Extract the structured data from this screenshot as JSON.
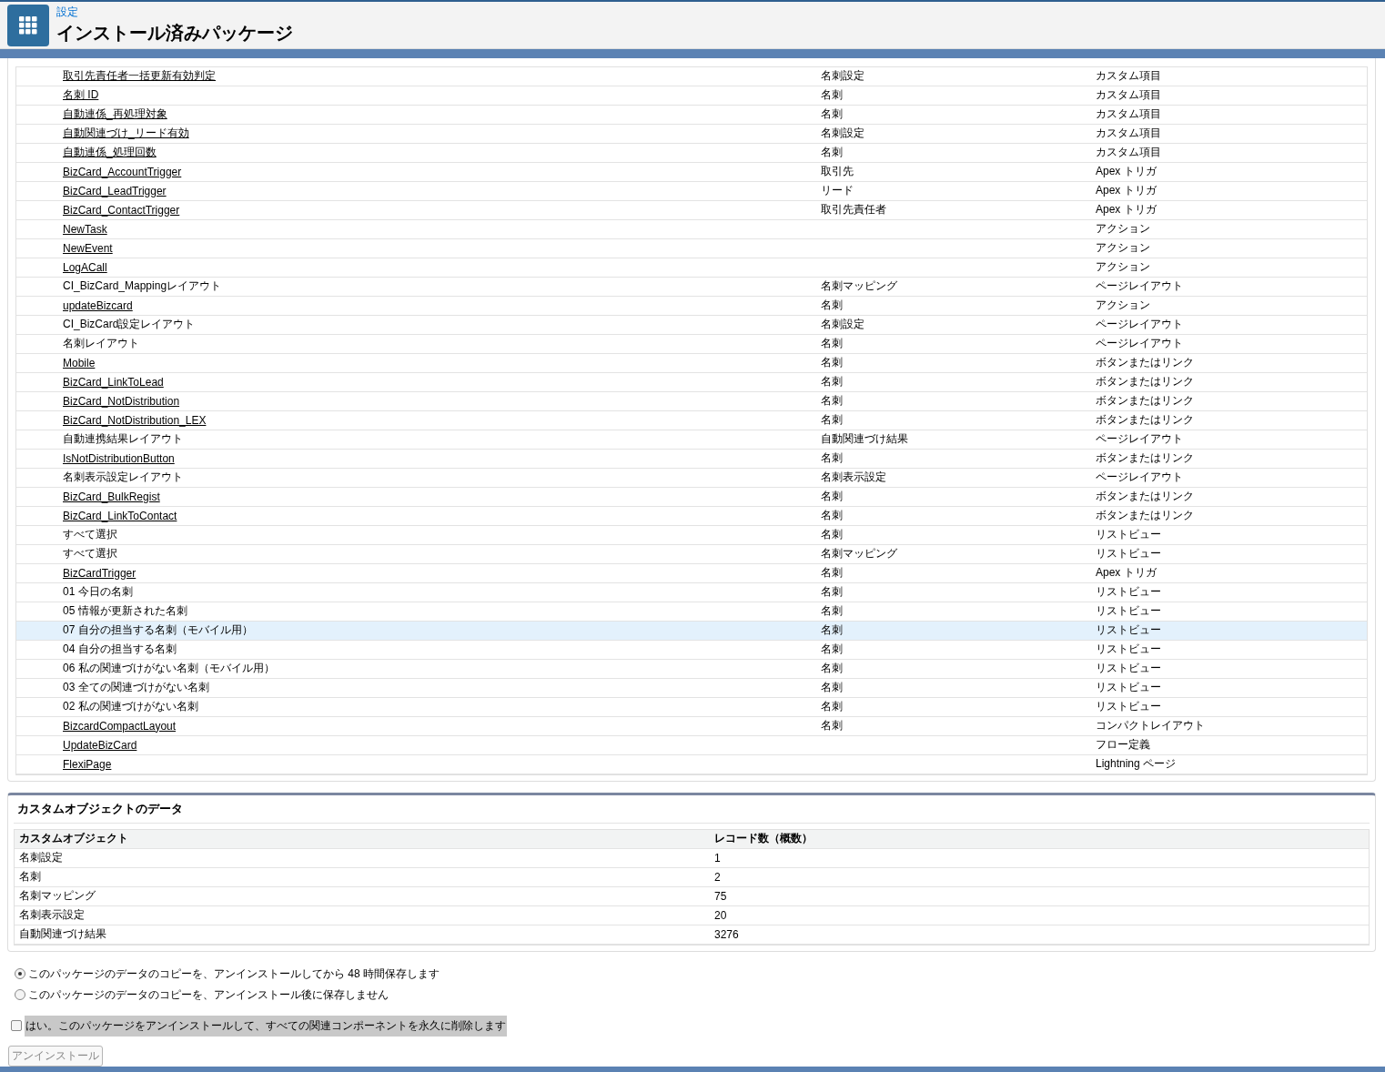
{
  "header": {
    "breadcrumb": "設定",
    "title": "インストール済みパッケージ"
  },
  "components": {
    "rows": [
      {
        "name": "取引先責任者一括更新有効判定",
        "kind": "link",
        "object": "名刺設定",
        "type": "カスタム項目",
        "highlighted": false
      },
      {
        "name": "名刺 ID",
        "kind": "link",
        "object": "名刺",
        "type": "カスタム項目",
        "highlighted": false
      },
      {
        "name": "自動連係_再処理対象",
        "kind": "link",
        "object": "名刺",
        "type": "カスタム項目",
        "highlighted": false
      },
      {
        "name": "自動関連づけ_リード有効",
        "kind": "link",
        "object": "名刺設定",
        "type": "カスタム項目",
        "highlighted": false
      },
      {
        "name": "自動連係_処理回数",
        "kind": "link",
        "object": "名刺",
        "type": "カスタム項目",
        "highlighted": false
      },
      {
        "name": "BizCard_AccountTrigger",
        "kind": "link",
        "object": "取引先",
        "type": "Apex トリガ",
        "highlighted": false
      },
      {
        "name": "BizCard_LeadTrigger",
        "kind": "link",
        "object": "リード",
        "type": "Apex トリガ",
        "highlighted": false
      },
      {
        "name": "BizCard_ContactTrigger",
        "kind": "link",
        "object": "取引先責任者",
        "type": "Apex トリガ",
        "highlighted": false
      },
      {
        "name": "NewTask",
        "kind": "link",
        "type": "アクション",
        "highlighted": false
      },
      {
        "name": "NewEvent",
        "kind": "link",
        "type": "アクション",
        "highlighted": false
      },
      {
        "name": "LogACall",
        "kind": "link",
        "type": "アクション",
        "highlighted": false
      },
      {
        "name": "CI_BizCard_Mappingレイアウト",
        "kind": "text",
        "object": "名刺マッピング",
        "type": "ページレイアウト",
        "highlighted": false
      },
      {
        "name": "updateBizcard",
        "kind": "link",
        "object": "名刺",
        "type": "アクション",
        "highlighted": false
      },
      {
        "name": "CI_BizCard設定レイアウト",
        "kind": "text",
        "object": "名刺設定",
        "type": "ページレイアウト",
        "highlighted": false
      },
      {
        "name": "名刺レイアウト",
        "kind": "text",
        "object": "名刺",
        "type": "ページレイアウト",
        "highlighted": false
      },
      {
        "name": "Mobile",
        "kind": "link",
        "object": "名刺",
        "type": "ボタンまたはリンク",
        "highlighted": false
      },
      {
        "name": "BizCard_LinkToLead",
        "kind": "link",
        "object": "名刺",
        "type": "ボタンまたはリンク",
        "highlighted": false
      },
      {
        "name": "BizCard_NotDistribution",
        "kind": "link",
        "object": "名刺",
        "type": "ボタンまたはリンク",
        "highlighted": false
      },
      {
        "name": "BizCard_NotDistribution_LEX",
        "kind": "link",
        "object": "名刺",
        "type": "ボタンまたはリンク",
        "highlighted": false
      },
      {
        "name": "自動連携結果レイアウト",
        "kind": "text",
        "object": "自動関連づけ結果",
        "type": "ページレイアウト",
        "highlighted": false
      },
      {
        "name": "IsNotDistributionButton",
        "kind": "link",
        "object": "名刺",
        "type": "ボタンまたはリンク",
        "highlighted": false
      },
      {
        "name": "名刺表示設定レイアウト",
        "kind": "text",
        "object": "名刺表示設定",
        "type": "ページレイアウト",
        "highlighted": false
      },
      {
        "name": "BizCard_BulkRegist",
        "kind": "link",
        "object": "名刺",
        "type": "ボタンまたはリンク",
        "highlighted": false
      },
      {
        "name": "BizCard_LinkToContact",
        "kind": "link",
        "object": "名刺",
        "type": "ボタンまたはリンク",
        "highlighted": false
      },
      {
        "name": "すべて選択",
        "kind": "text",
        "object": "名刺",
        "type": "リストビュー",
        "highlighted": false
      },
      {
        "name": "すべて選択",
        "kind": "text",
        "object": "名刺マッピング",
        "type": "リストビュー",
        "highlighted": false
      },
      {
        "name": "BizCardTrigger",
        "kind": "link",
        "object": "名刺",
        "type": "Apex トリガ",
        "highlighted": false
      },
      {
        "name": "01 今日の名刺",
        "kind": "text",
        "object": "名刺",
        "type": "リストビュー",
        "highlighted": false
      },
      {
        "name": "05 情報が更新された名刺",
        "kind": "text",
        "object": "名刺",
        "type": "リストビュー",
        "highlighted": false
      },
      {
        "name": "07 自分の担当する名刺（モバイル用）",
        "kind": "text",
        "object": "名刺",
        "type": "リストビュー",
        "highlighted": true
      },
      {
        "name": "04 自分の担当する名刺",
        "kind": "text",
        "object": "名刺",
        "type": "リストビュー",
        "highlighted": false
      },
      {
        "name": "06 私の関連づけがない名刺（モバイル用）",
        "kind": "text",
        "object": "名刺",
        "type": "リストビュー",
        "highlighted": false
      },
      {
        "name": "03 全ての関連づけがない名刺",
        "kind": "text",
        "object": "名刺",
        "type": "リストビュー",
        "highlighted": false
      },
      {
        "name": "02 私の関連づけがない名刺",
        "kind": "text",
        "object": "名刺",
        "type": "リストビュー",
        "highlighted": false
      },
      {
        "name": "BizcardCompactLayout",
        "kind": "link",
        "object": "名刺",
        "type": "コンパクトレイアウト",
        "highlighted": false
      },
      {
        "name": "UpdateBizCard",
        "kind": "link",
        "type": "フロー定義",
        "highlighted": false
      },
      {
        "name": "FlexiPage",
        "kind": "link",
        "type": "Lightning ページ",
        "highlighted": false
      }
    ]
  },
  "custom_object_data": {
    "title": "カスタムオブジェクトのデータ",
    "columns": [
      "カスタムオブジェクト",
      "レコード数（概数）"
    ],
    "rows": [
      {
        "object": "名刺設定",
        "count": "1"
      },
      {
        "object": "名刺",
        "count": "2"
      },
      {
        "object": "名刺マッピング",
        "count": "75"
      },
      {
        "object": "名刺表示設定",
        "count": "20"
      },
      {
        "object": "自動関連づけ結果",
        "count": "3276"
      }
    ]
  },
  "data_options": [
    {
      "label": "このパッケージのデータのコピーを、アンインストールしてから 48 時間保存します",
      "selected": true
    },
    {
      "label": "このパッケージのデータのコピーを、アンインストール後に保存しません",
      "selected": false
    }
  ],
  "confirm": {
    "label": "はい。このパッケージをアンインストールして、すべての関連コンポーネントを永久に削除します",
    "checked": false
  },
  "uninstall_button": {
    "label": "アンインストール",
    "disabled": true
  }
}
